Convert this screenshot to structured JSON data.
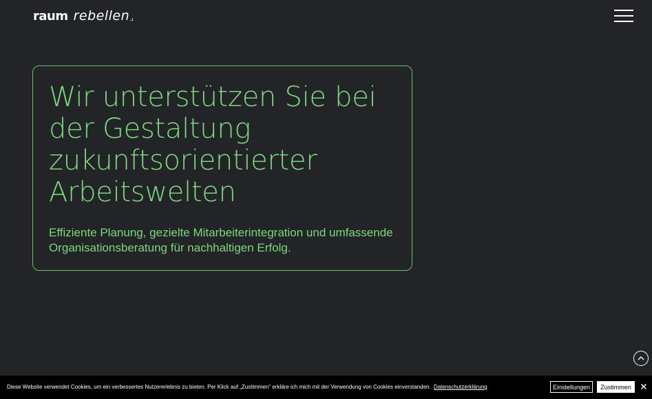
{
  "header": {
    "logo_bold": "raum",
    "logo_light": "rebellen",
    "logo_mark": "⌟"
  },
  "hero": {
    "title": "Wir unterstützen Sie bei der Gestaltung zukunftsorientierter Arbeitswelten",
    "subtitle": "Effiziente Planung, gezielte Mitarbeiterintegration und umfassende Organisationsberatung für nachhaltigen Erfolg."
  },
  "cookie": {
    "text": "Diese Website verwendet Cookies, um ein verbessertes Nutzererlebnis zu bieten. Per Klick auf „Zustimmen“ erkläre ich mich mit der Verwendung von Cookies einverstanden.",
    "privacy_link": "Datenschutzerklärung",
    "settings_label": "Einstellungen",
    "accept_label": "Zustimmen"
  },
  "icons": {
    "menu": "hamburger-menu-icon",
    "scroll_top": "chevron-up-icon",
    "close": "close-icon"
  },
  "colors": {
    "background": "#232428",
    "accent": "#7dd87d",
    "border": "#6ac46a",
    "cookie_bar": "#000000"
  }
}
